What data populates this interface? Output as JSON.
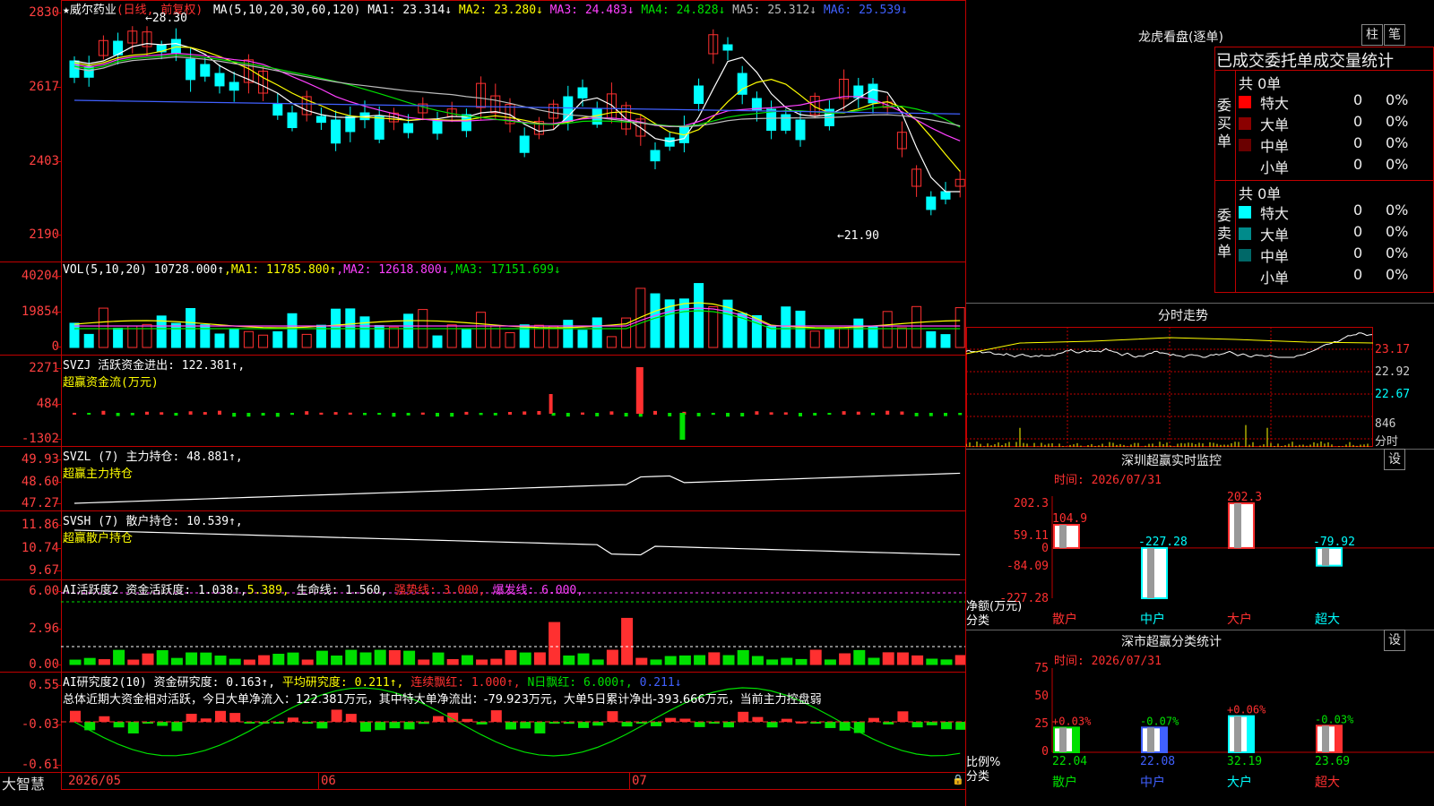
{
  "stock": {
    "star": "★",
    "name": "威尔药业",
    "period": "(日线, 前复权)"
  },
  "kline": {
    "ma_label": "MA(5,10,20,30,60,120)",
    "ma": [
      {
        "k": "MA1",
        "v": "23.314↓",
        "c": "#ffffff"
      },
      {
        "k": "MA2",
        "v": "23.280↓",
        "c": "#ffff00"
      },
      {
        "k": "MA3",
        "v": "24.483↓",
        "c": "#ff40ff"
      },
      {
        "k": "MA4",
        "v": "24.828↓",
        "c": "#00e000"
      },
      {
        "k": "MA5",
        "v": "25.312↓",
        "c": "#bbbbbb"
      },
      {
        "k": "MA6",
        "v": "25.539↓",
        "c": "#4060ff"
      }
    ],
    "yticks": [
      "2830",
      "2617",
      "2403",
      "2190"
    ],
    "high_mark": "28.30",
    "low_mark": "21.90"
  },
  "vol": {
    "label": "VOL(5,10,20)",
    "value": "10728.000↑",
    "ma": [
      {
        "k": "MA1",
        "v": "11785.800↑",
        "c": "#ffff00"
      },
      {
        "k": "MA2",
        "v": "12618.800↓",
        "c": "#ff40ff"
      },
      {
        "k": "MA3",
        "v": "17151.699↓",
        "c": "#00e000"
      }
    ],
    "yticks": [
      "40204",
      "19854",
      "0"
    ]
  },
  "svzj": {
    "label": "SVZJ",
    "name": "活跃资金进出:",
    "value": "122.381↑,",
    "sub": "超赢资金流(万元)",
    "yticks": [
      "2271",
      "484",
      "-1302"
    ]
  },
  "svzl": {
    "label": "SVZL (7)",
    "name": "主力持仓:",
    "value": "48.881↑,",
    "sub": "超赢主力持仓",
    "yticks": [
      "49.93",
      "48.60",
      "47.27"
    ]
  },
  "svsh": {
    "label": "SVSH (7)",
    "name": "散户持仓:",
    "value": "10.539↑,",
    "sub": "超赢散户持仓",
    "yticks": [
      "11.86",
      "10.74",
      "9.67"
    ]
  },
  "ai1": {
    "label": "AI活跃度2",
    "t1": "资金活跃度:",
    "v1": "1.038↑,",
    "v2": "5.389,",
    "t3": "生命线:",
    "v3": "1.560,",
    "t4": "强势线:",
    "v4": "3.000,",
    "t5": "爆发线:",
    "v5": "6.000,",
    "yticks": [
      "6.00",
      "2.96",
      "0.00"
    ]
  },
  "ai2": {
    "label": "AI研究度2(10)",
    "t1": "资金研究度:",
    "v1": "0.163↑,",
    "t2": "平均研究度:",
    "v2": "0.211↑,",
    "t3": "连续飘红:",
    "v3": "1.000↑,",
    "t4": "N日飘红:",
    "v4": "6.000↑,",
    "v5": "0.211↓",
    "summary": "总体近期大资金相对活跃，今日大单净流入：122.381万元，其中特大单净流出：-79.923万元，大单5日累计净出-393.666万元，当前主力控盘弱",
    "yticks": [
      "0.55",
      "-0.03",
      "-0.61"
    ]
  },
  "xaxis": {
    "labels": [
      "2026/05",
      "06",
      "07"
    ]
  },
  "brand": "大智慧",
  "right": {
    "title": "龙虎看盘(逐单)",
    "btn1": "柱",
    "btn2": "笔",
    "stat_title": "已成交委托单成交量统计",
    "buy": {
      "side": "委买单",
      "total": "共 0单",
      "rows": [
        {
          "n": "特大",
          "v": "0",
          "p": "0%",
          "c": "#ff0000"
        },
        {
          "n": "大单",
          "v": "0",
          "p": "0%",
          "c": "#8b0000"
        },
        {
          "n": "中单",
          "v": "0",
          "p": "0%",
          "c": "#6a0000"
        },
        {
          "n": "小单",
          "v": "0",
          "p": "0%",
          "c": "#000000"
        }
      ]
    },
    "sell": {
      "side": "委卖单",
      "total": "共 0单",
      "rows": [
        {
          "n": "特大",
          "v": "0",
          "p": "0%",
          "c": "#00ffff"
        },
        {
          "n": "大单",
          "v": "0",
          "p": "0%",
          "c": "#008b8b"
        },
        {
          "n": "中单",
          "v": "0",
          "p": "0%",
          "c": "#006868"
        },
        {
          "n": "小单",
          "v": "0",
          "p": "0%",
          "c": "#000000"
        }
      ]
    },
    "fs": {
      "title": "分时走势",
      "yticks": [
        "23.17",
        "22.92",
        "22.67",
        "846"
      ],
      "unit": "分时"
    },
    "sz": {
      "title": "深圳超赢实时监控",
      "btn": "设",
      "time": "时间: 2026/07/31",
      "yticks": [
        "202.3",
        "59.11",
        "0",
        "-84.09",
        "-227.28"
      ],
      "bars": [
        {
          "v": 104.9,
          "t": "104.9",
          "c": "#ff3030"
        },
        {
          "v": -227.28,
          "t": "-227.28",
          "c": "#00ffff"
        },
        {
          "v": 202.3,
          "t": "202.3",
          "c": "#ff3030"
        },
        {
          "v": -79.92,
          "t": "-79.92",
          "c": "#00ffff"
        }
      ],
      "cats": [
        "散户",
        "中户",
        "大户",
        "超大"
      ],
      "ylab1": "净额(万元)",
      "ylab2": "分类"
    },
    "fl": {
      "title": "深市超赢分类统计",
      "btn": "设",
      "time": "时间: 2026/07/31",
      "yticks": [
        "75",
        "50",
        "25",
        "0"
      ],
      "bars": [
        {
          "v": 22.04,
          "t": "22.04",
          "d": "+0.03%",
          "c": "#00e000",
          "dc": "#ff3030"
        },
        {
          "v": 22.08,
          "t": "22.08",
          "d": "-0.07%",
          "c": "#4060ff",
          "dc": "#00e000"
        },
        {
          "v": 32.19,
          "t": "32.19",
          "d": "+0.06%",
          "c": "#00ffff",
          "dc": "#ff3030"
        },
        {
          "v": 23.69,
          "t": "23.69",
          "d": "-0.03%",
          "c": "#ff3030",
          "dc": "#00e000"
        }
      ],
      "cats": [
        "散户",
        "中户",
        "大户",
        "超大"
      ],
      "ylab1": "比例%",
      "ylab2": "分类"
    }
  }
}
